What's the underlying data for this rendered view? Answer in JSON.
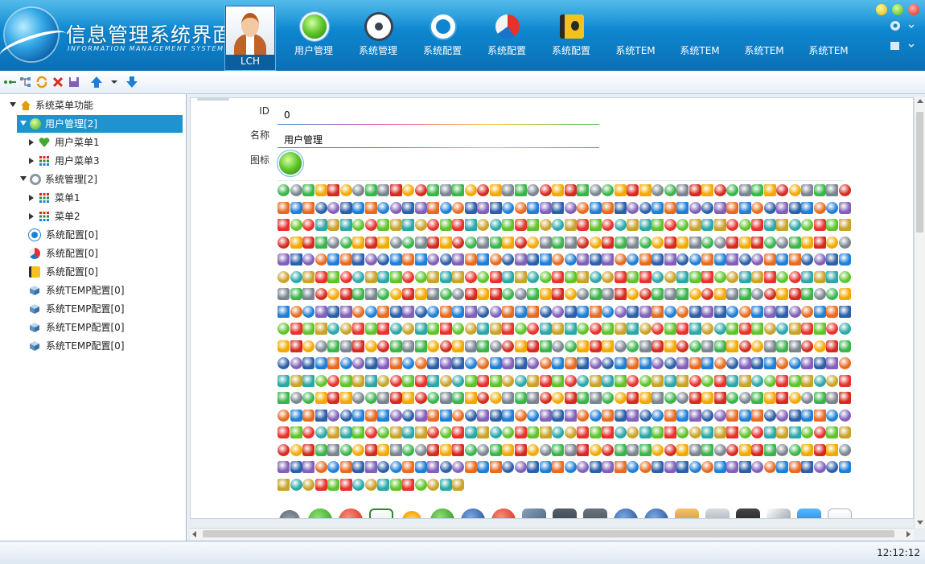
{
  "app": {
    "title": "信息管理系统界面",
    "subtitle": "INFORMATION MANAGEMENT SYSTEM GUI",
    "user_name": "LCH"
  },
  "nav": [
    {
      "label": "用户管理",
      "icon": "green-orb-icon"
    },
    {
      "label": "系统管理",
      "icon": "gear-icon"
    },
    {
      "label": "系统配置",
      "icon": "ring-icon"
    },
    {
      "label": "系统配置",
      "icon": "beach-ball-icon"
    },
    {
      "label": "系统配置",
      "icon": "address-book-icon"
    },
    {
      "label": "系统TEM",
      "icon": ""
    },
    {
      "label": "系统TEM",
      "icon": ""
    },
    {
      "label": "系统TEM",
      "icon": ""
    },
    {
      "label": "系统TEM",
      "icon": ""
    }
  ],
  "toolbar": {
    "icons": [
      "add-node-icon",
      "tree-icon",
      "refresh-icon",
      "delete-icon",
      "save-icon",
      "move-up-icon",
      "dropdown-icon",
      "move-down-icon"
    ]
  },
  "tree": {
    "root": "系统菜单功能",
    "items": [
      {
        "label": "用户管理[2]",
        "level": 1,
        "expanded": true,
        "selected": true
      },
      {
        "label": "用户菜单1",
        "level": 2,
        "expanded": false
      },
      {
        "label": "用户菜单3",
        "level": 2,
        "expanded": false
      },
      {
        "label": "系统管理[2]",
        "level": 1,
        "expanded": true
      },
      {
        "label": "菜单1",
        "level": 2,
        "expanded": false
      },
      {
        "label": "菜单2",
        "level": 2,
        "expanded": false
      },
      {
        "label": "系统配置[0]",
        "level": 1
      },
      {
        "label": "系统配置[0]",
        "level": 1
      },
      {
        "label": "系统配置[0]",
        "level": 1
      },
      {
        "label": "系统TEMP配置[0]",
        "level": 1
      },
      {
        "label": "系统TEMP配置[0]",
        "level": 1
      },
      {
        "label": "系统TEMP配置[0]",
        "level": 1
      },
      {
        "label": "系统TEMP配置[0]",
        "level": 1
      }
    ]
  },
  "form": {
    "id_label": "ID",
    "id_value": "0",
    "name_label": "名称",
    "name_value": "用户管理",
    "icon_label": "图标"
  },
  "status": {
    "clock": "12:12:12"
  },
  "colors": {
    "header": "#0e86cf",
    "selection": "#1f93d0",
    "accent_green": "#5ec42a"
  }
}
